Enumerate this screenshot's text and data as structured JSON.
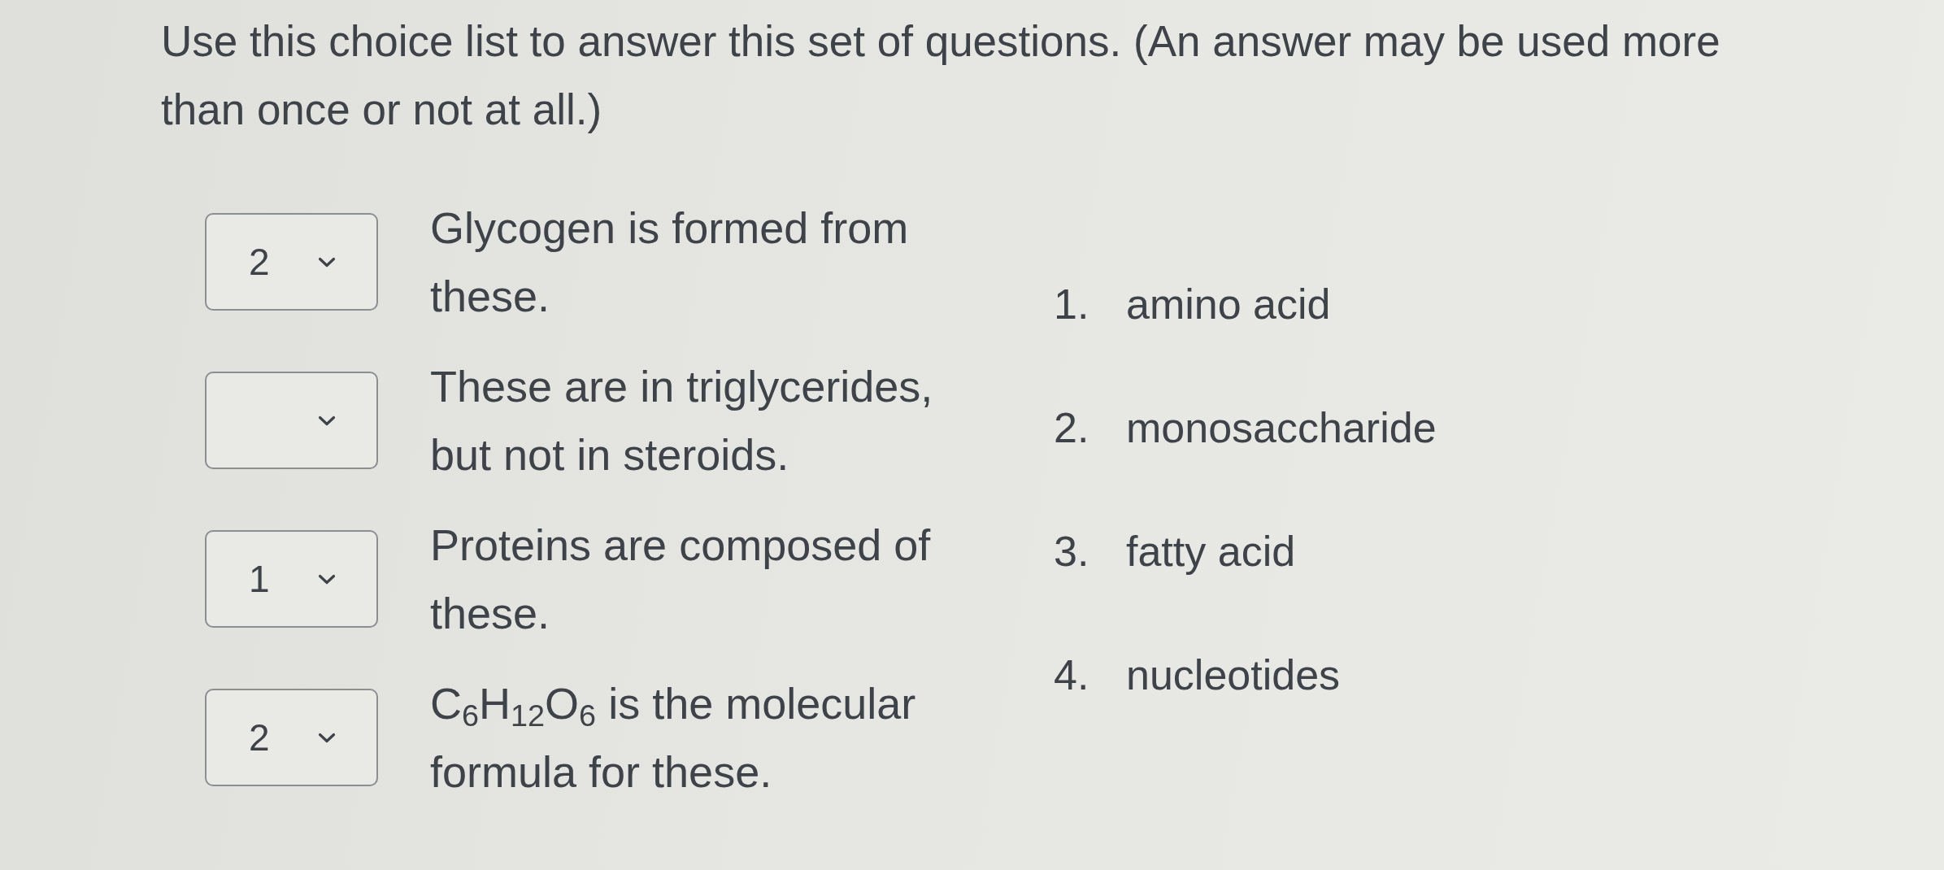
{
  "instructions": "Use this choice list to answer this set of questions. (An answer may be used more than once or not at all.)",
  "questions": [
    {
      "answer": "2",
      "text": "Glycogen is formed from these."
    },
    {
      "text": "These are in triglycerides, but not in steroids."
    },
    {
      "answer": "1",
      "text": "Proteins are composed of these."
    },
    {
      "answer": "2",
      "text": "C$_{6}$H$_{12}$O$_{6}$ is the molecular formula for these."
    }
  ],
  "choices": [
    {
      "number": "1.",
      "label": "amino acid"
    },
    {
      "number": "2.",
      "label": "monosaccharide"
    },
    {
      "number": "3.",
      "label": "fatty acid"
    },
    {
      "number": "4.",
      "label": "nucleotides"
    }
  ]
}
